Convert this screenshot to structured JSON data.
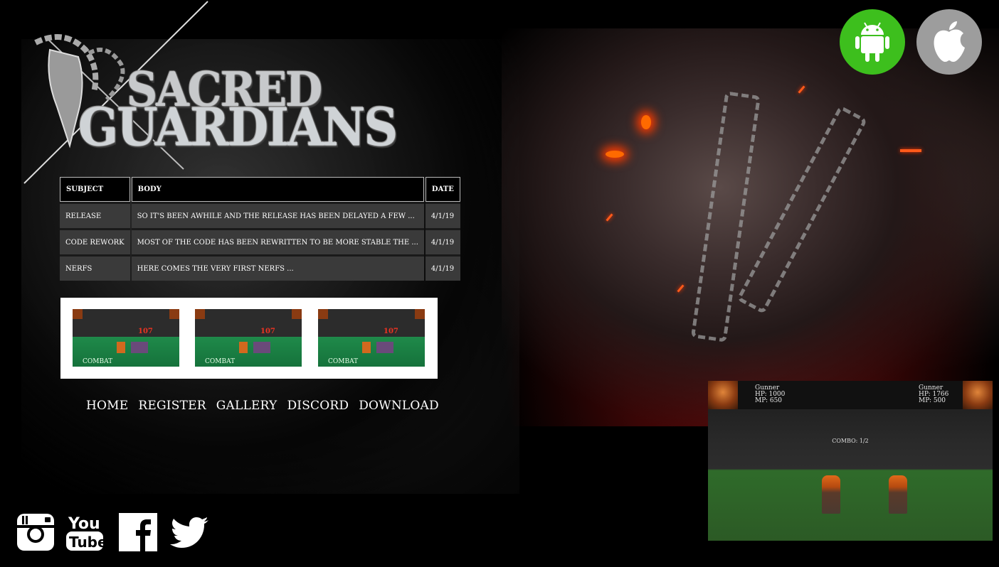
{
  "store_buttons": [
    {
      "name": "android-icon",
      "color": "#3dbf1d"
    },
    {
      "name": "apple-icon",
      "color": "#9d9d9d"
    }
  ],
  "logo": {
    "line1": "SACRED",
    "line2": "GUARDIANS"
  },
  "news": {
    "headers": [
      "SUBJECT",
      "BODY",
      "DATE"
    ],
    "rows": [
      {
        "subject": "RELEASE",
        "body": "SO IT'S BEEN AWHILE AND THE RELEASE HAS BEEN DELAYED A FEW ...",
        "date": "4/1/19"
      },
      {
        "subject": "CODE REWORK",
        "body": "MOST OF THE CODE HAS BEEN REWRITTEN TO BE MORE STABLE THE ...",
        "date": "4/1/19"
      },
      {
        "subject": "NERFS",
        "body": "HERE COMES THE VERY FIRST NERFS ...",
        "date": "4/1/19"
      }
    ]
  },
  "gallery": {
    "items": [
      {
        "label": "COMBAT",
        "damage": "107"
      },
      {
        "label": "COMBAT",
        "damage": "107"
      },
      {
        "label": "COMBAT",
        "damage": "107"
      }
    ]
  },
  "nav": {
    "items": [
      "HOME",
      "REGISTER",
      "GALLERY",
      "DISCORD",
      "DOWNLOAD"
    ]
  },
  "social": [
    "instagram-icon",
    "youtube-icon",
    "facebook-icon",
    "twitter-icon"
  ],
  "game_preview": {
    "left": {
      "name": "Gunner",
      "hp": "HP: 1000",
      "mp": "MP: 650"
    },
    "right": {
      "name": "Gunner",
      "hp": "HP: 1766",
      "mp": "MP: 500"
    },
    "combo": "COMBO: 1/2"
  }
}
